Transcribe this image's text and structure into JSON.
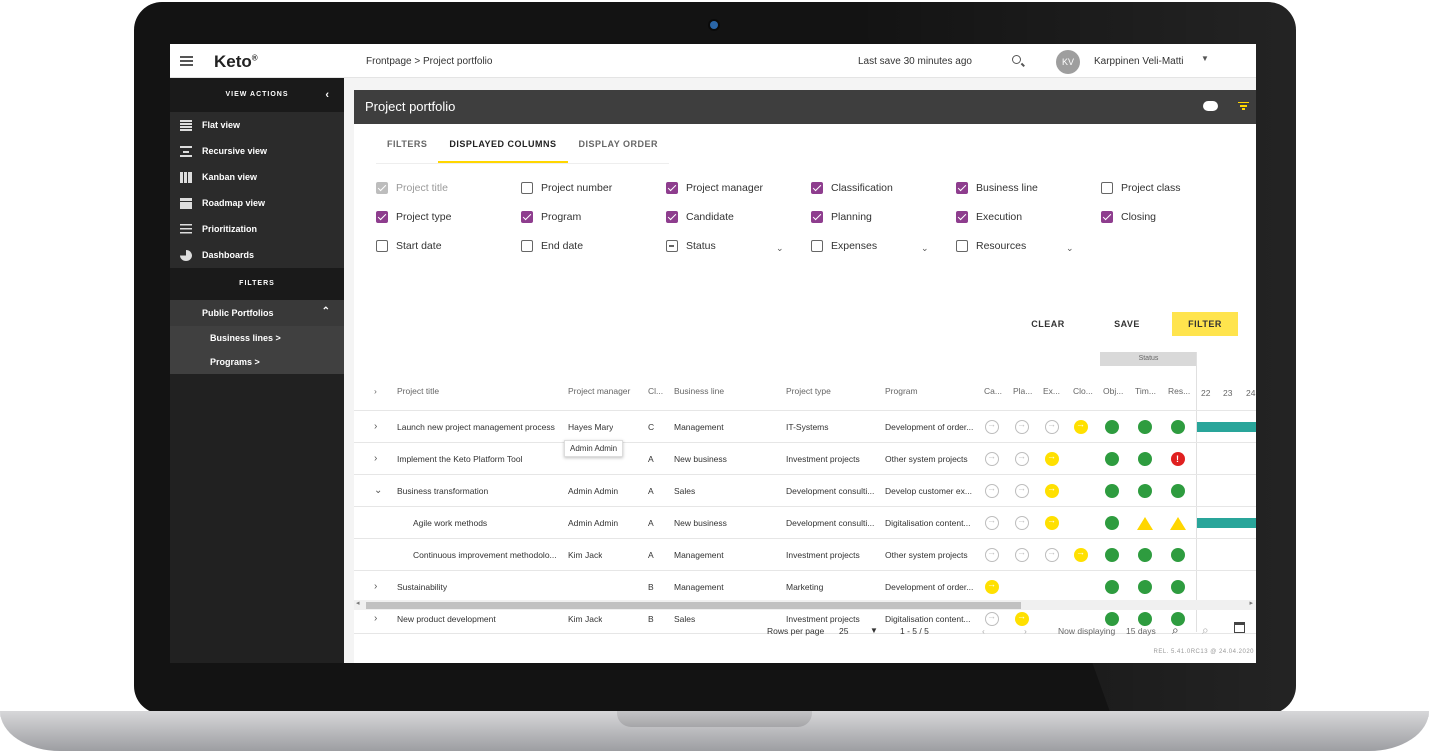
{
  "app": {
    "logo": "Keto",
    "logo_mark": "®"
  },
  "topbar": {
    "breadcrumb": "Frontpage > Project portfolio",
    "last_save": "Last save 30 minutes ago",
    "avatar_initials": "KV",
    "user_name": "Karppinen Veli-Matti"
  },
  "sidebar": {
    "view_actions_label": "VIEW ACTIONS",
    "items": [
      {
        "label": "Flat view",
        "icon": "list-icon"
      },
      {
        "label": "Recursive view",
        "icon": "recursive-icon"
      },
      {
        "label": "Kanban view",
        "icon": "kanban-icon"
      },
      {
        "label": "Roadmap view",
        "icon": "roadmap-icon"
      },
      {
        "label": "Prioritization",
        "icon": "prioritization-icon"
      },
      {
        "label": "Dashboards",
        "icon": "pie-chart-icon"
      }
    ],
    "filters_label": "FILTERS",
    "public_portfolios": "Public Portfolios",
    "sub_items": [
      "Business lines >",
      "Programs >"
    ]
  },
  "panel": {
    "title": "Project portfolio",
    "tabs": [
      "FILTERS",
      "DISPLAYED COLUMNS",
      "DISPLAY ORDER"
    ],
    "active_tab": 1,
    "columns": [
      {
        "label": "Project title",
        "state": "disabled"
      },
      {
        "label": "Project number",
        "state": "off"
      },
      {
        "label": "Project manager",
        "state": "on"
      },
      {
        "label": "Classification",
        "state": "on"
      },
      {
        "label": "Business line",
        "state": "on"
      },
      {
        "label": "Project class",
        "state": "off"
      },
      {
        "label": "Project type",
        "state": "on"
      },
      {
        "label": "Program",
        "state": "on"
      },
      {
        "label": "Candidate",
        "state": "on"
      },
      {
        "label": "Planning",
        "state": "on"
      },
      {
        "label": "Execution",
        "state": "on"
      },
      {
        "label": "Closing",
        "state": "on"
      },
      {
        "label": "Start date",
        "state": "off"
      },
      {
        "label": "End date",
        "state": "off"
      },
      {
        "label": "Status",
        "state": "indeterminate"
      },
      {
        "label": "Expenses",
        "state": "off"
      },
      {
        "label": "Resources",
        "state": "off"
      }
    ],
    "buttons": {
      "clear": "CLEAR",
      "save": "SAVE",
      "filter": "FILTER"
    }
  },
  "table": {
    "status_group": "Status",
    "headers": [
      "Project title",
      "Project manager",
      "Cl...",
      "Business line",
      "Project type",
      "Program",
      "Ca...",
      "Pla...",
      "Ex...",
      "Clo...",
      "Obj...",
      "Tim...",
      "Res..."
    ],
    "gantt_days": [
      "22",
      "23",
      "24"
    ],
    "rows": [
      {
        "expander": "›",
        "title": "Launch new project management process",
        "manager": "Hayes Mary",
        "cl": "C",
        "business": "Management",
        "type": "IT-Systems",
        "program": "Development of order..."
      },
      {
        "expander": "›",
        "title": "Implement the Keto Platform Tool",
        "manager": "",
        "cl": "A",
        "business": "New business",
        "type": "Investment projects",
        "program": "Other system projects"
      },
      {
        "expander": "⌄",
        "title": "Business transformation",
        "manager": "Admin Admin",
        "cl": "A",
        "business": "Sales",
        "type": "Development consulti...",
        "program": "Develop customer ex..."
      },
      {
        "expander": "",
        "title": "Agile work methods",
        "manager": "Admin Admin",
        "cl": "A",
        "business": "New business",
        "type": "Development consulti...",
        "program": "Digitalisation content..."
      },
      {
        "expander": "",
        "title": "Continuous improvement methodolo...",
        "manager": "Kim Jack",
        "cl": "A",
        "business": "Management",
        "type": "Investment projects",
        "program": "Other system projects"
      },
      {
        "expander": "›",
        "title": "Sustainability",
        "manager": "",
        "cl": "B",
        "business": "Management",
        "type": "Marketing",
        "program": "Development of order..."
      },
      {
        "expander": "›",
        "title": "New product development",
        "manager": "Kim Jack",
        "cl": "B",
        "business": "Sales",
        "type": "Investment projects",
        "program": "Digitalisation content..."
      }
    ],
    "tooltip": "Admin Admin"
  },
  "pager": {
    "rows_per_page_label": "Rows per page",
    "rows_per_page": "25",
    "range": "1 - 5 / 5",
    "now_displaying_label": "Now displaying",
    "now_displaying": "15 days"
  },
  "release": "REL. 5.41.0RC13 @ 24.04.2020",
  "colors": {
    "accent": "#ffe44d",
    "checkbox": "#8e3d8e",
    "green": "#2e9c3f",
    "yellow": "#ffe000",
    "red": "#e02020",
    "gantt": "#29a59a"
  }
}
